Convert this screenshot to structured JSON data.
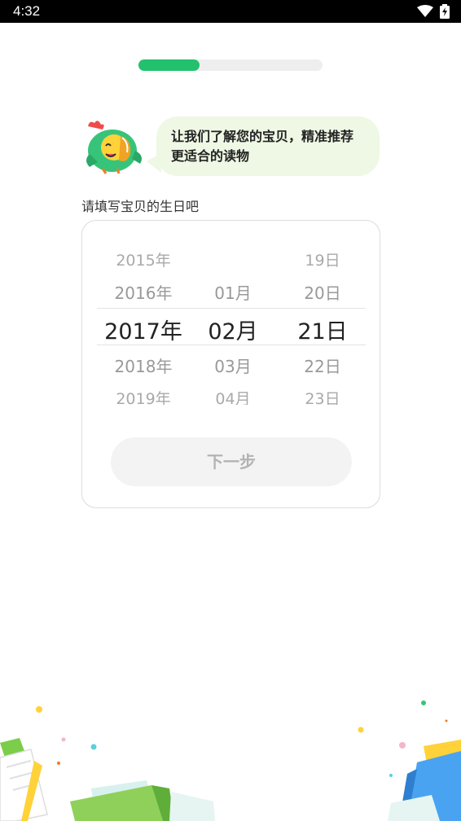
{
  "status_bar": {
    "time": "4:32"
  },
  "progress": {
    "fraction": 0.33,
    "color": "#23c06e"
  },
  "bubble": {
    "line1": "让我们了解您的宝贝，精准推荐",
    "line2": "更适合的读物"
  },
  "prompt": "请填写宝贝的生日吧",
  "picker": {
    "years": [
      "2015年",
      "2016年",
      "2017年",
      "2018年",
      "2019年"
    ],
    "months": [
      "",
      "01月",
      "02月",
      "03月",
      "04月"
    ],
    "days": [
      "19日",
      "20日",
      "21日",
      "22日",
      "23日"
    ],
    "selected": {
      "year": "2017年",
      "month": "02月",
      "day": "21日"
    }
  },
  "next_button": {
    "label": "下一步"
  },
  "colors": {
    "accent": "#23c06e",
    "bubble_bg": "#eef8e4"
  }
}
